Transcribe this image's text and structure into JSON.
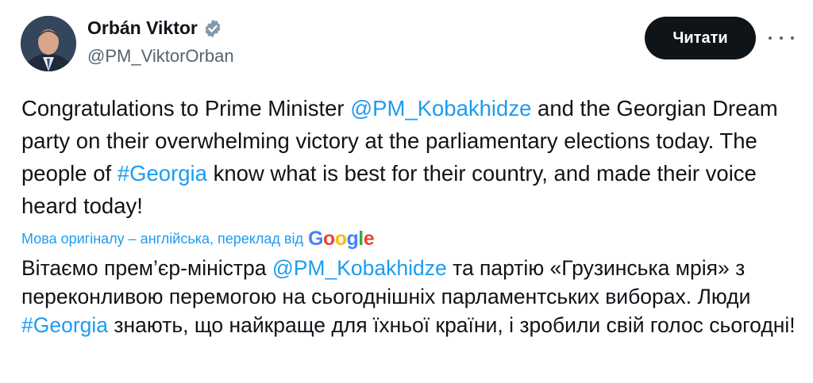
{
  "author": {
    "name": "Orbán Viktor",
    "handle": "@PM_ViktorOrban"
  },
  "actions": {
    "read_label": "Читати"
  },
  "tweet": {
    "part1": "Congratulations to Prime Minister ",
    "mention1": "@PM_Kobakhidze",
    "part2": " and the Georgian Dream party on their overwhelming victory at the parliamentary elections today. The people of ",
    "hashtag1": "#Georgia",
    "part3": " know what is best for their country, and made their voice heard today!"
  },
  "translation": {
    "note": "Мова оригіналу – англійська, переклад від",
    "provider": "Google",
    "part1": "Вітаємо прем’єр-міністра ",
    "mention1": "@PM_Kobakhidze",
    "part2": " та партію «Грузинська мрія» з переконливою перемогою на сьогоднішніх парламентських виборах. Люди ",
    "hashtag1": "#Georgia",
    "part3": " знають, що найкраще для їхньої країни, і зробили свій голос сьогодні!"
  },
  "colors": {
    "link": "#1d9bf0",
    "text": "#0f1419",
    "secondary": "#536471",
    "button_bg": "#0f1419"
  },
  "icons": [
    "verified-badge-icon",
    "more-options-icon",
    "google-logo"
  ]
}
